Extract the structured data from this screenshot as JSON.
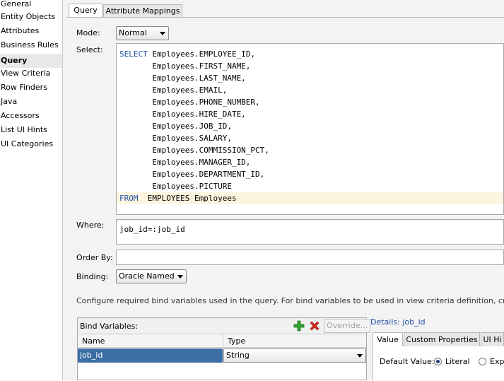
{
  "sidebar": {
    "items": [
      {
        "label": "General"
      },
      {
        "label": "Entity Objects"
      },
      {
        "label": "Attributes"
      },
      {
        "label": "Business Rules"
      },
      {
        "label": "Query",
        "selected": true
      },
      {
        "label": "View Criteria"
      },
      {
        "label": "Row Finders"
      },
      {
        "label": "Java"
      },
      {
        "label": "Accessors"
      },
      {
        "label": "List UI Hints"
      },
      {
        "label": "UI Categories"
      }
    ]
  },
  "tabs": [
    {
      "label": "Query",
      "active": true
    },
    {
      "label": "Attribute Mappings",
      "active": false
    }
  ],
  "mode": {
    "label": "Mode:",
    "value": "Normal"
  },
  "select": {
    "label": "Select:",
    "lines": [
      {
        "kw": "SELECT",
        "text": " Employees.EMPLOYEE_ID,"
      },
      {
        "kw": "",
        "text": "       Employees.FIRST_NAME,"
      },
      {
        "kw": "",
        "text": "       Employees.LAST_NAME,"
      },
      {
        "kw": "",
        "text": "       Employees.EMAIL,"
      },
      {
        "kw": "",
        "text": "       Employees.PHONE_NUMBER,"
      },
      {
        "kw": "",
        "text": "       Employees.HIRE_DATE,"
      },
      {
        "kw": "",
        "text": "       Employees.JOB_ID,"
      },
      {
        "kw": "",
        "text": "       Employees.SALARY,"
      },
      {
        "kw": "",
        "text": "       Employees.COMMISSION_PCT,"
      },
      {
        "kw": "",
        "text": "       Employees.MANAGER_ID,"
      },
      {
        "kw": "",
        "text": "       Employees.DEPARTMENT_ID,"
      },
      {
        "kw": "",
        "text": "       Employees.PICTURE"
      },
      {
        "kw": "FROM",
        "text": "  EMPLOYEES Employees"
      }
    ]
  },
  "where": {
    "label": "Where:",
    "value": "job_id=:job_id"
  },
  "order_by": {
    "label": "Order By:",
    "value": ""
  },
  "binding": {
    "label": "Binding:",
    "value": "Oracle Named"
  },
  "info_text": "Configure required bind variables used in the query.  For bind variables to be used in view criteria definition, create them in the",
  "bind_variables": {
    "title": "Bind Variables:",
    "override_label": "Override...",
    "columns": [
      "Name",
      "Type"
    ],
    "rows": [
      {
        "name": "job_id",
        "type": "String"
      }
    ]
  },
  "details": {
    "title": "Details: job_id",
    "tabs": [
      "Value",
      "Custom Properties",
      "UI Hi"
    ],
    "default_value_label": "Default Value:",
    "options": [
      "Literal",
      "Expr"
    ]
  },
  "colors": {
    "keyword": "#1f4fa6",
    "selection": "#3a6ea5",
    "highlight": "#fdf5df"
  }
}
